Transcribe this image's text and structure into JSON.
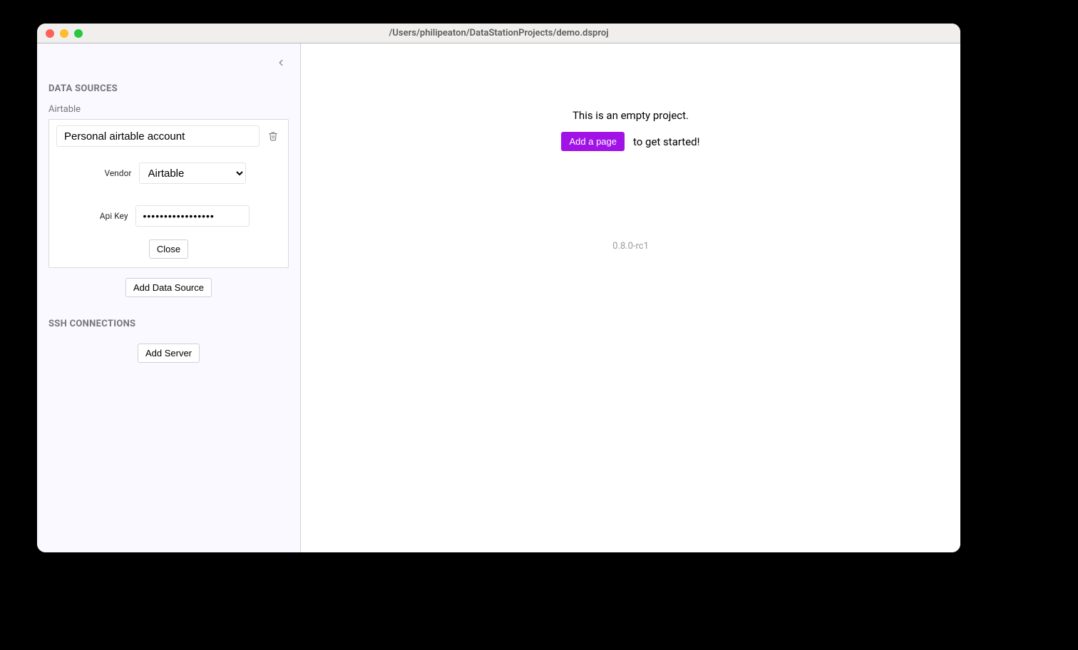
{
  "window": {
    "title": "/Users/philipeaton/DataStationProjects/demo.dsproj"
  },
  "sidebar": {
    "sections": {
      "data_sources": {
        "header": "DATA SOURCES",
        "group_label": "Airtable",
        "card": {
          "name_value": "Personal airtable account",
          "vendor_label": "Vendor",
          "vendor_value": "Airtable",
          "api_key_label": "Api Key",
          "api_key_value": "•••••••••••••••••",
          "close_label": "Close"
        },
        "add_button": "Add Data Source"
      },
      "ssh": {
        "header": "SSH CONNECTIONS",
        "add_button": "Add Server"
      }
    }
  },
  "main": {
    "empty_text": "This is an empty project.",
    "add_page_label": "Add a page",
    "cta_tail": "to get started!",
    "version": "0.8.0-rc1"
  }
}
